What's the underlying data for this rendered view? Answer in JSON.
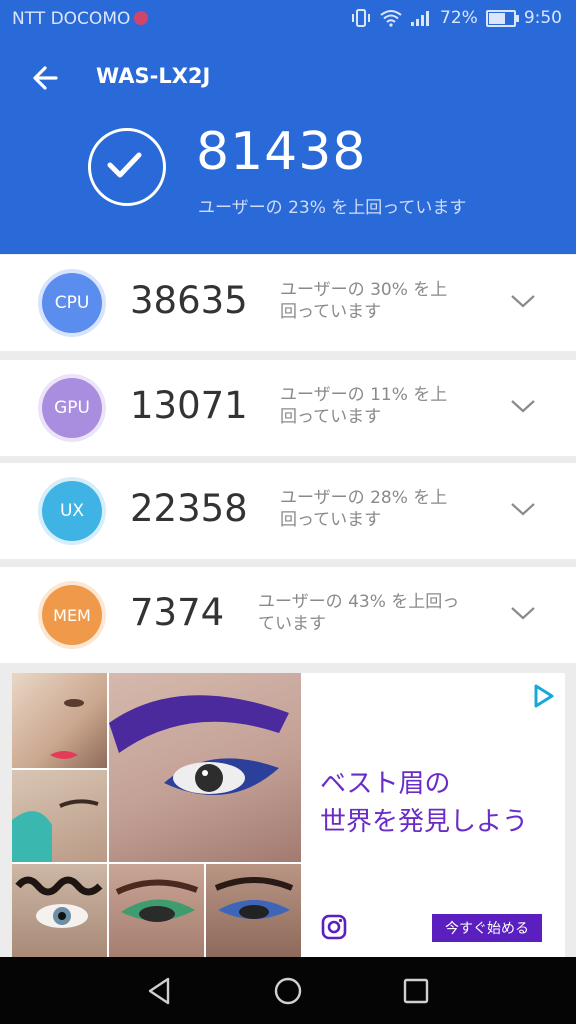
{
  "status_bar": {
    "carrier": "NTT DOCOMO",
    "battery_percent": "72%",
    "battery_level": 0.72,
    "time": "9:50",
    "icons": [
      "vibrate-icon",
      "wifi-icon",
      "signal-icon",
      "battery-icon"
    ]
  },
  "header": {
    "device_name": "WAS-LX2J",
    "total_score": "81438",
    "total_description": "ユーザーの 23% を上回っています",
    "back_icon": "arrow-left-icon",
    "status_icon": "check-circle-icon"
  },
  "scores": [
    {
      "label": "CPU",
      "score": "38635",
      "desc_line1": "ユーザーの 30% を上",
      "desc_line2": "回っています",
      "color": "#5b8def"
    },
    {
      "label": "GPU",
      "score": "13071",
      "desc_line1": "ユーザーの 11% を上",
      "desc_line2": "回っています",
      "color": "#a98ee0"
    },
    {
      "label": "UX",
      "score": "22358",
      "desc_line1": "ユーザーの 28% を上",
      "desc_line2": "回っています",
      "color": "#3fb4e4"
    },
    {
      "label": "MEM",
      "score": "7374",
      "desc_line1": "ユーザーの 43% を上回っ",
      "desc_line2": "ています",
      "color": "#ef9a4a"
    }
  ],
  "ad": {
    "headline_line1": "ベスト眉の",
    "headline_line2": "世界を発見しよう",
    "cta": "今すぐ始める",
    "accent": "#5b1fc0"
  },
  "nav": {
    "icons": [
      "back-triangle-icon",
      "home-circle-icon",
      "recents-square-icon"
    ]
  }
}
